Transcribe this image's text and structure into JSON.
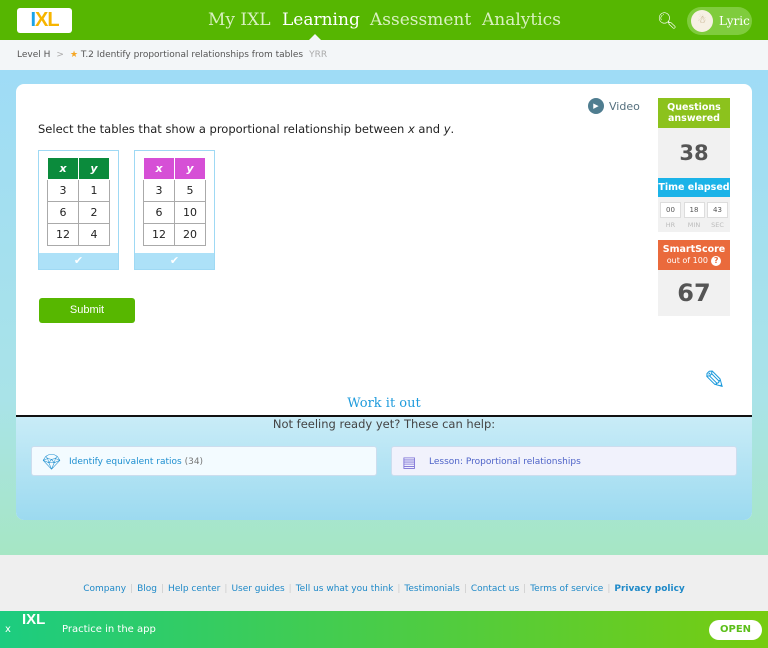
{
  "header": {
    "logo": "IXL",
    "nav": [
      "My IXL",
      "Learning",
      "Assessment",
      "Analytics"
    ],
    "active": "Learning",
    "user": "Lyric"
  },
  "breadcrumb": {
    "level": "Level H",
    "skill": "T.2 Identify proportional relationships from tables",
    "code": "YRR"
  },
  "question": {
    "prefix": "Select the tables that show a proportional relationship between ",
    "x": "x",
    "and": " and ",
    "y": "y",
    "suffix": "."
  },
  "tables": [
    {
      "headers": [
        "x",
        "y"
      ],
      "rows": [
        [
          "3",
          "1"
        ],
        [
          "6",
          "2"
        ],
        [
          "12",
          "4"
        ]
      ],
      "color": "#0b8b3c"
    },
    {
      "headers": [
        "x",
        "y"
      ],
      "rows": [
        [
          "3",
          "5"
        ],
        [
          "6",
          "10"
        ],
        [
          "12",
          "20"
        ]
      ],
      "color": "#d64fd6"
    }
  ],
  "check": "✔",
  "submit": "Submit",
  "video": "Video",
  "stats": {
    "questions_label": "Questions answered",
    "questions": "38",
    "time_label": "Time elapsed",
    "hr": "00",
    "min": "18",
    "sec": "43",
    "hr_l": "HR",
    "min_l": "MIN",
    "sec_l": "SEC",
    "smartscore_label": "SmartScore",
    "out_of": "out of 100",
    "help": "?",
    "smartscore": "67"
  },
  "work": {
    "title": "Work it out",
    "ready": "Not feeling ready yet? These can help:",
    "items": [
      {
        "label": "Identify equivalent ratios",
        "count": "(34)"
      },
      {
        "label": "Lesson: Proportional relationships"
      }
    ]
  },
  "footer": {
    "links": [
      "Company",
      "Blog",
      "Help center",
      "User guides",
      "Tell us what you think",
      "Testimonials",
      "Contact us",
      "Terms of service",
      "Privacy policy"
    ]
  },
  "banner": {
    "close": "x",
    "logo": "IXL",
    "text": "Practice in the app",
    "open": "OPEN"
  }
}
